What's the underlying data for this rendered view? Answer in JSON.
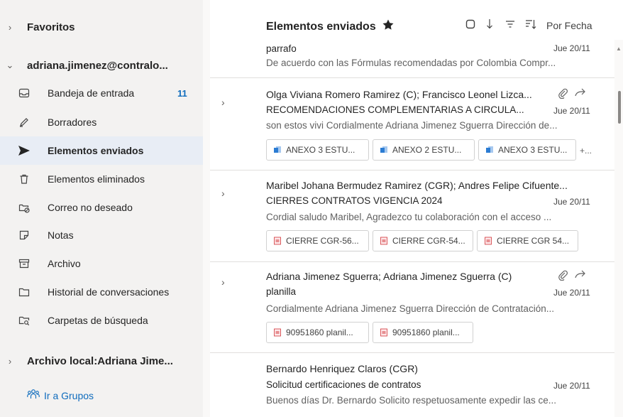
{
  "sidebar": {
    "favorites": "Favoritos",
    "account": "adriana.jimenez@contralo...",
    "items": [
      {
        "label": "Bandeja de entrada",
        "count": "11",
        "icon": "inbox-icon"
      },
      {
        "label": "Borradores",
        "count": "",
        "icon": "drafts-icon"
      },
      {
        "label": "Elementos enviados",
        "count": "",
        "icon": "send-icon"
      },
      {
        "label": "Elementos eliminados",
        "count": "",
        "icon": "trash-icon"
      },
      {
        "label": "Correo no deseado",
        "count": "",
        "icon": "junk-icon"
      },
      {
        "label": "Notas",
        "count": "",
        "icon": "notes-icon"
      },
      {
        "label": "Archivo",
        "count": "",
        "icon": "archive-icon"
      },
      {
        "label": "Historial de conversaciones",
        "count": "",
        "icon": "folder-icon"
      },
      {
        "label": "Carpetas de búsqueda",
        "count": "",
        "icon": "search-folder-icon"
      }
    ],
    "local_archive": "Archivo local:Adriana Jime...",
    "groups_link": "Ir a Grupos"
  },
  "header": {
    "title": "Elementos enviados",
    "sort_label": "Por Fecha"
  },
  "messages": [
    {
      "from": "",
      "subject": "parrafo",
      "date": "Jue 20/11",
      "preview": "De acuerdo con las Fórmulas recomendadas por Colombia Compr...",
      "attachments": [],
      "more": ""
    },
    {
      "from": "Olga Viviana Romero Ramirez (C); Francisco Leonel Lizca...",
      "subject": "RECOMENDACIONES COMPLEMENTARIAS A CIRCULA...",
      "date": "Jue 20/11",
      "preview": "son estos vivi Cordialmente Adriana Jimenez Sguerra Dirección de...",
      "attachments": [
        "ANEXO 3 ESTU...",
        "ANEXO 2 ESTU...",
        "ANEXO 3 ESTU..."
      ],
      "more": "+..."
    },
    {
      "from": "Maribel Johana Bermudez Ramirez (CGR); Andres Felipe Cifuente...",
      "subject": "CIERRES CONTRATOS VIGENCIA 2024",
      "date": "Jue 20/11",
      "preview": "Cordial saludo Maribel, Agradezco tu colaboración con el acceso ...",
      "attachments": [
        "CIERRE CGR-56...",
        "CIERRE CGR-54...",
        "CIERRE CGR 54..."
      ],
      "more": ""
    },
    {
      "from": "Adriana Jimenez Sguerra; Adriana Jimenez Sguerra (C)",
      "subject": "planilla",
      "date": "Jue 20/11",
      "preview": "Cordialmente Adriana Jimenez Sguerra Dirección de Contratación...",
      "attachments": [
        "90951860 planil...",
        "90951860 planil..."
      ],
      "more": ""
    },
    {
      "from": "Bernardo Henriquez Claros (CGR)",
      "subject": "Solicitud certificaciones de contratos",
      "date": "Jue 20/11",
      "preview": "Buenos días Dr. Bernardo Solicito respetuosamente expedir las ce...",
      "attachments": [],
      "more": ""
    }
  ],
  "colors": {
    "accent": "#0f6cbd",
    "sidebar_bg": "#f3f2f1",
    "selected_bg": "#e8edf5",
    "word_icon": "#2b7cd3",
    "pdf_icon": "#d13438"
  }
}
